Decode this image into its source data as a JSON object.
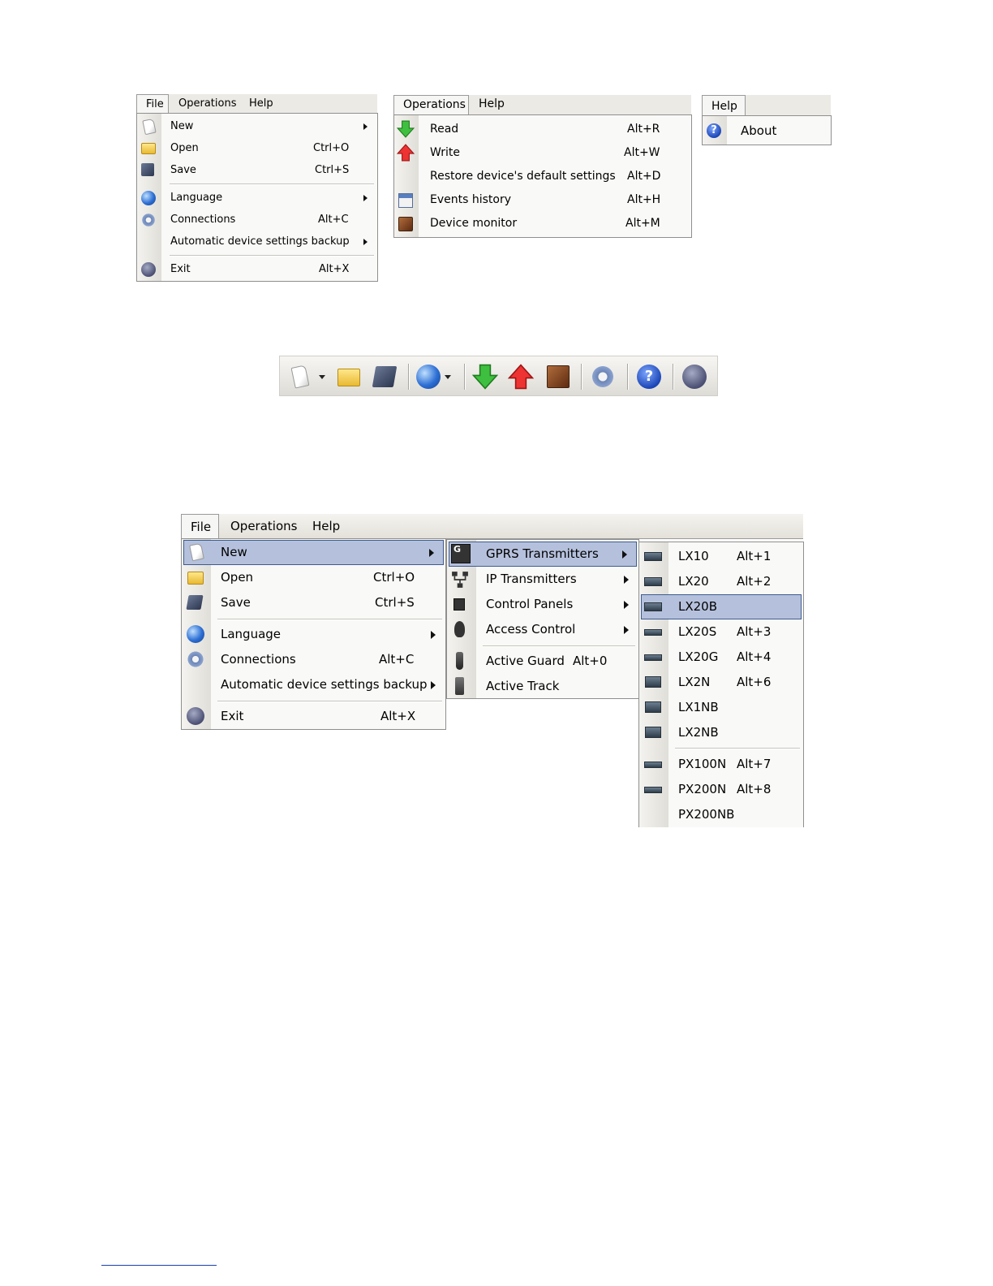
{
  "menu1": {
    "bar": [
      "File",
      "Operations",
      "Help"
    ],
    "items": [
      {
        "label": "New",
        "shortcut": "",
        "submenu": true,
        "icon": "new-document-icon"
      },
      {
        "label": "Open",
        "shortcut": "Ctrl+O",
        "icon": "open-folder-icon"
      },
      {
        "label": "Save",
        "shortcut": "Ctrl+S",
        "icon": "save-disk-icon"
      },
      {
        "label": "Language",
        "shortcut": "",
        "submenu": true,
        "icon": "globe-icon"
      },
      {
        "label": "Connections",
        "shortcut": "Alt+C",
        "icon": "gear-icon"
      },
      {
        "label": "Automatic device settings backup",
        "shortcut": "",
        "submenu": true,
        "icon": ""
      },
      {
        "label": "Exit",
        "shortcut": "Alt+X",
        "icon": "exit-icon"
      }
    ]
  },
  "menu2": {
    "bar": [
      "Operations",
      "Help"
    ],
    "items": [
      {
        "label": "Read",
        "shortcut": "Alt+R",
        "icon": "read-down-arrow-icon"
      },
      {
        "label": "Write",
        "shortcut": "Alt+W",
        "icon": "write-up-arrow-icon"
      },
      {
        "label": "Restore device's default settings",
        "shortcut": "Alt+D",
        "icon": ""
      },
      {
        "label": "Events history",
        "shortcut": "Alt+H",
        "icon": "calendar-icon"
      },
      {
        "label": "Device monitor",
        "shortcut": "Alt+M",
        "icon": "monitor-icon"
      }
    ]
  },
  "menu3": {
    "bar": [
      "Help"
    ],
    "items": [
      {
        "label": "About",
        "icon": "help-icon"
      }
    ]
  },
  "toolbar": {
    "buttons": [
      "new-document-icon",
      "open-folder-icon",
      "save-disk-icon",
      "globe-icon",
      "read-down-arrow-icon",
      "write-up-arrow-icon",
      "monitor-icon",
      "gear-icon",
      "help-icon",
      "exit-icon"
    ]
  },
  "big": {
    "bar": [
      "File",
      "Operations",
      "Help"
    ],
    "file_items": [
      {
        "label": "New",
        "shortcut": ""
      },
      {
        "label": "Open",
        "shortcut": "Ctrl+O"
      },
      {
        "label": "Save",
        "shortcut": "Ctrl+S"
      },
      {
        "label": "Language",
        "shortcut": ""
      },
      {
        "label": "Connections",
        "shortcut": "Alt+C"
      },
      {
        "label": "Automatic device settings backup",
        "shortcut": ""
      },
      {
        "label": "Exit",
        "shortcut": "Alt+X"
      }
    ],
    "new_items": [
      {
        "label": "GPRS Transmitters",
        "shortcut": ""
      },
      {
        "label": "IP Transmitters",
        "shortcut": ""
      },
      {
        "label": "Control Panels",
        "shortcut": ""
      },
      {
        "label": "Access Control",
        "shortcut": ""
      },
      {
        "label": "Active Guard",
        "shortcut": "Alt+0"
      },
      {
        "label": "Active Track",
        "shortcut": ""
      }
    ],
    "gprs_items": [
      {
        "label": "LX10",
        "shortcut": "Alt+1"
      },
      {
        "label": "LX20",
        "shortcut": "Alt+2"
      },
      {
        "label": "LX20B",
        "shortcut": ""
      },
      {
        "label": "LX20S",
        "shortcut": "Alt+3"
      },
      {
        "label": "LX20G",
        "shortcut": "Alt+4"
      },
      {
        "label": "LX2N",
        "shortcut": "Alt+6"
      },
      {
        "label": "LX1NB",
        "shortcut": ""
      },
      {
        "label": "LX2NB",
        "shortcut": ""
      },
      {
        "label": "PX100N",
        "shortcut": "Alt+7"
      },
      {
        "label": "PX200N",
        "shortcut": "Alt+8"
      },
      {
        "label": "PX200NB",
        "shortcut": ""
      }
    ]
  }
}
